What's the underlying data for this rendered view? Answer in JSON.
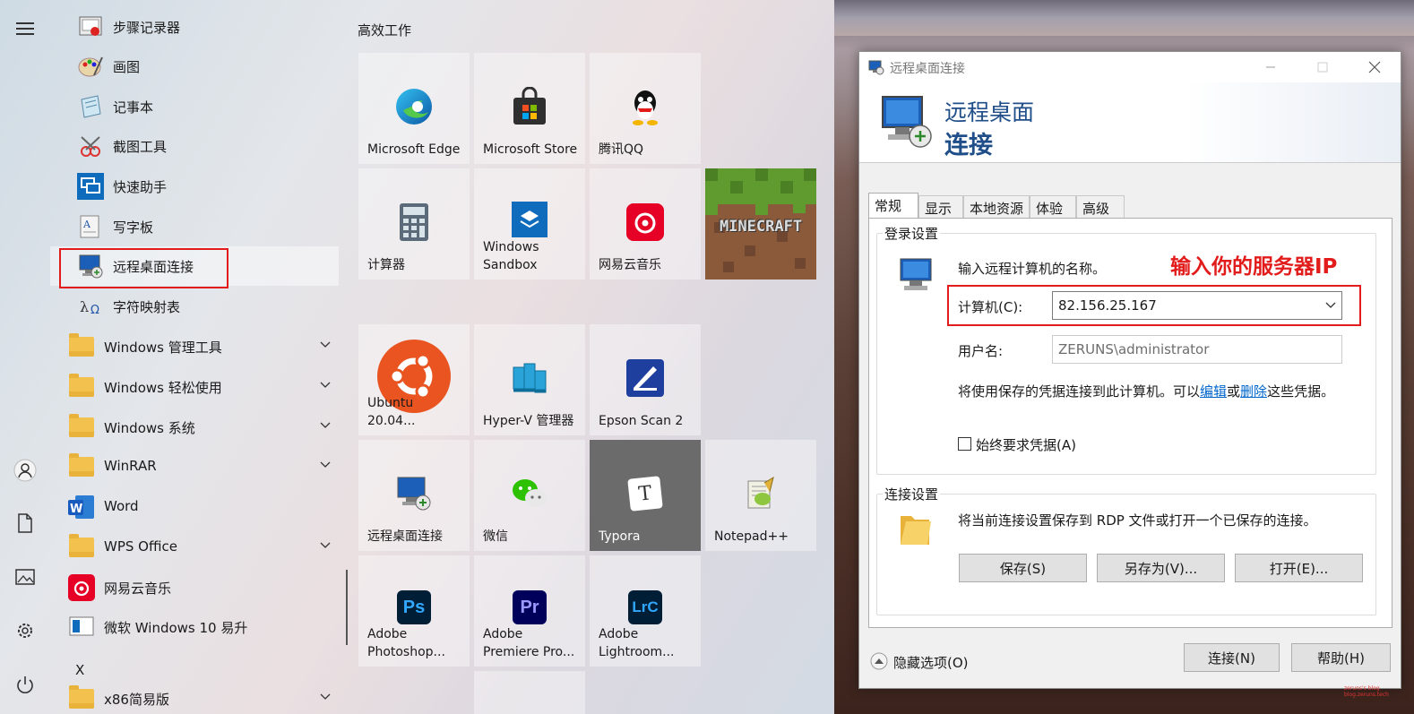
{
  "start_menu": {
    "rail": {
      "icons": [
        "hamburger-icon",
        "user-icon",
        "document-icon",
        "pictures-icon",
        "settings-icon",
        "power-icon"
      ]
    },
    "apps": [
      {
        "label": "步骤记录器",
        "icon": "steps-recorder-icon"
      },
      {
        "label": "画图",
        "icon": "paint-icon"
      },
      {
        "label": "记事本",
        "icon": "notepad-icon"
      },
      {
        "label": "截图工具",
        "icon": "snipping-tool-icon"
      },
      {
        "label": "快速助手",
        "icon": "quick-assist-icon"
      },
      {
        "label": "写字板",
        "icon": "wordpad-icon"
      },
      {
        "label": "远程桌面连接",
        "icon": "remote-desktop-icon"
      },
      {
        "label": "字符映射表",
        "icon": "character-map-icon"
      },
      {
        "label": "Windows 管理工具",
        "icon": "folder-icon"
      },
      {
        "label": "Windows 轻松使用",
        "icon": "folder-icon"
      },
      {
        "label": "Windows 系统",
        "icon": "folder-icon"
      },
      {
        "label": "WinRAR",
        "icon": "folder-icon"
      },
      {
        "label": "Word",
        "icon": "word-icon"
      },
      {
        "label": "WPS Office",
        "icon": "folder-icon"
      },
      {
        "label": "网易云音乐",
        "icon": "netease-music-icon"
      },
      {
        "label": "微软 Windows 10 易升",
        "icon": "windows-update-assistant-icon"
      },
      {
        "label": "X",
        "icon": ""
      },
      {
        "label": "x86简易版",
        "icon": "folder-icon"
      }
    ],
    "tiles_group_title": "高效工作",
    "tiles": [
      {
        "label": "Microsoft Edge",
        "icon": "edge-icon"
      },
      {
        "label": "Microsoft Store",
        "icon": "store-icon"
      },
      {
        "label": "腾讯QQ",
        "icon": "qq-icon"
      },
      {
        "label": "计算器",
        "icon": "calculator-icon"
      },
      {
        "label": "Windows\nSandbox",
        "icon": "sandbox-icon"
      },
      {
        "label": "网易云音乐",
        "icon": "netease-music-icon"
      },
      {
        "label": "",
        "icon": "minecraft-icon",
        "text": "MINECRAFT"
      },
      {
        "label": "Ubuntu 20.04...",
        "icon": "ubuntu-icon"
      },
      {
        "label": "Hyper-V 管理器",
        "icon": "hyperv-icon"
      },
      {
        "label": "Epson Scan 2",
        "icon": "epson-scan-icon"
      },
      {
        "label": "远程桌面连接",
        "icon": "remote-desktop-icon"
      },
      {
        "label": "微信",
        "icon": "wechat-icon"
      },
      {
        "label": "Typora",
        "icon": "typora-icon",
        "glyph": "T"
      },
      {
        "label": "Notepad++",
        "icon": "notepadpp-icon"
      },
      {
        "label": "Adobe\nPhotoshop...",
        "icon": "photoshop-icon",
        "glyph": "Ps"
      },
      {
        "label": "Adobe\nPremiere Pro...",
        "icon": "premiere-icon",
        "glyph": "Pr"
      },
      {
        "label": "Adobe\nLightroom...",
        "icon": "lightroom-icon",
        "glyph": "LrC"
      }
    ]
  },
  "rdp_dialog": {
    "window_title": "远程桌面连接",
    "banner_line1": "远程桌面",
    "banner_line2": "连接",
    "tabs": [
      "常规",
      "显示",
      "本地资源",
      "体验",
      "高级"
    ],
    "login_group": "登录设置",
    "prompt": "输入远程计算机的名称。",
    "computer_label": "计算机(C):",
    "computer_value": "82.156.25.167",
    "username_label": "用户名:",
    "username_value": "ZERUNS\\administrator",
    "cred_text_before": "将使用保存的凭据连接到此计算机。可以",
    "cred_link_edit": "编辑",
    "cred_text_or": "或",
    "cred_link_delete": "删除",
    "cred_text_after": "这些凭据。",
    "always_ask": "始终要求凭据(A)",
    "conn_group": "连接设置",
    "conn_text": "将当前连接设置保存到 RDP 文件或打开一个已保存的连接。",
    "save_btn": "保存(S)",
    "saveas_btn": "另存为(V)...",
    "open_btn": "打开(E)...",
    "hide_options": "隐藏选项(O)",
    "connect_btn": "连接(N)",
    "help_btn": "帮助(H)"
  },
  "annotation": "输入你的服务器IP",
  "watermark_line1": "zeruns's blog",
  "watermark_line2": "blog.zeruns.tech",
  "colors": {
    "annotation": "#e21b1b",
    "banner_text": "#1f4e89",
    "link": "#0066cc"
  }
}
